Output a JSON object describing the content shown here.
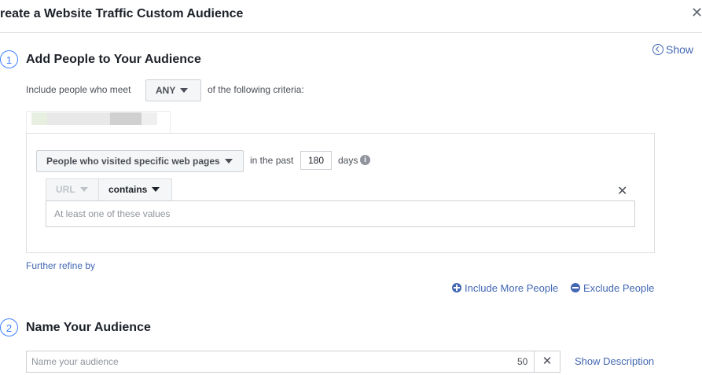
{
  "header": {
    "title": "reate a Website Traffic Custom Audience",
    "close_symbol": "✕"
  },
  "show_link": {
    "label": "Show",
    "icon": "chevron-left-circle-icon"
  },
  "step1": {
    "number": "1",
    "title": "Add People to Your Audience",
    "include_prefix": "Include people who meet",
    "match_value": "ANY",
    "include_suffix": "of the following criteria:",
    "rule": {
      "event_select": "People who visited specific web pages",
      "in_the_past_label": "in the past",
      "days_value": "180",
      "days_label": "days",
      "info_symbol": "i",
      "url_select": "URL",
      "operator_select": "contains",
      "values_placeholder": "At least one of these values",
      "remove_symbol": "✕"
    },
    "further_refine": "Further refine by",
    "include_more": "Include More People",
    "exclude": "Exclude People"
  },
  "step2": {
    "number": "2",
    "title": "Name Your Audience",
    "name_placeholder": "Name your audience",
    "char_count": "50",
    "clear_symbol": "✕",
    "show_description": "Show Description"
  },
  "colors": {
    "accent": "#4267b2",
    "step_circle": "#4080ff",
    "border": "#dddfe2"
  }
}
